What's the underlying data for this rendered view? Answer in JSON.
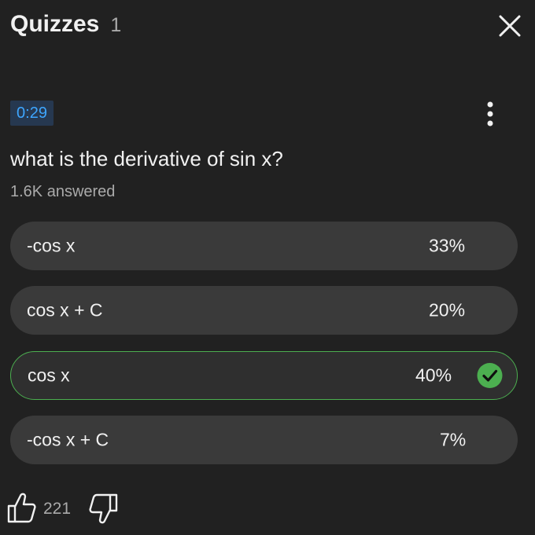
{
  "header": {
    "title": "Quizzes",
    "count": "1"
  },
  "quiz": {
    "timestamp": "0:29",
    "question": "what is the derivative of sin x?",
    "answered": "1.6K answered",
    "options": [
      {
        "label": "-cos x",
        "percent": "33%",
        "correct": false
      },
      {
        "label": "cos x + C",
        "percent": "20%",
        "correct": false
      },
      {
        "label": "cos x",
        "percent": "40%",
        "correct": true
      },
      {
        "label": "-cos x + C",
        "percent": "7%",
        "correct": false
      }
    ]
  },
  "footer": {
    "like_count": "221"
  },
  "colors": {
    "background": "#212121",
    "option_bg": "#3a3a3a",
    "correct_border": "#4caf50",
    "timestamp_text": "#3ea6ff"
  },
  "icons": {
    "close": "close-icon",
    "more": "more-vertical-icon",
    "check": "check-circle-icon",
    "like": "thumbs-up-icon",
    "dislike": "thumbs-down-icon"
  }
}
